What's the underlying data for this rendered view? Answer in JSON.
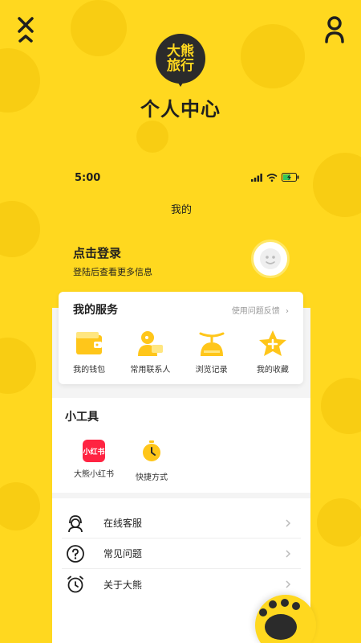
{
  "header": {
    "logo_line1": "大熊",
    "logo_line2": "旅行",
    "title": "个人中心"
  },
  "status_bar": {
    "time": "5:00"
  },
  "page": {
    "title": "我的"
  },
  "login": {
    "title": "点击登录",
    "subtitle": "登陆后查看更多信息"
  },
  "services": {
    "title": "我的服务",
    "feedback_label": "使用问题反馈",
    "items": [
      {
        "label": "我的钱包",
        "icon": "wallet-icon"
      },
      {
        "label": "常用联系人",
        "icon": "contact-icon"
      },
      {
        "label": "浏览记录",
        "icon": "history-icon"
      },
      {
        "label": "我的收藏",
        "icon": "favorite-star-icon"
      }
    ]
  },
  "tools": {
    "title": "小工具",
    "items": [
      {
        "label": "大熊小红书",
        "badge": "小红书",
        "icon": "xiaohongshu-icon"
      },
      {
        "label": "快捷方式",
        "icon": "stopwatch-icon"
      }
    ]
  },
  "links": [
    {
      "label": "在线客服",
      "icon": "customer-service-icon"
    },
    {
      "label": "常见问题",
      "icon": "question-icon"
    },
    {
      "label": "关于大熊",
      "icon": "alarm-clock-icon"
    }
  ],
  "colors": {
    "brand_yellow": "#FFD81F",
    "dark": "#2B2B2B",
    "red": "#FF2442"
  }
}
